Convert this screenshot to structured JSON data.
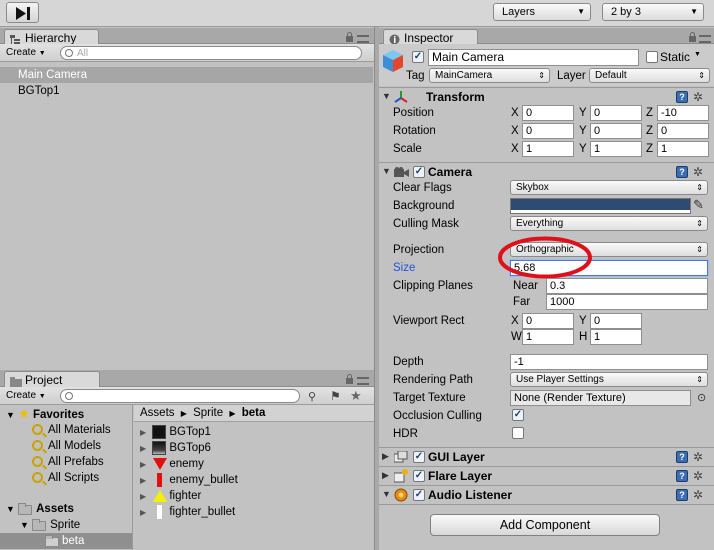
{
  "toolbar": {
    "step_icon": "step-forward-icon",
    "layers_label": "Layers",
    "layout_label": "2 by 3"
  },
  "hierarchy": {
    "tab_label": "Hierarchy",
    "create_label": "Create",
    "search_placeholder": "All",
    "items": [
      {
        "label": "Main Camera"
      },
      {
        "label": "BGTop1"
      }
    ]
  },
  "project": {
    "tab_label": "Project",
    "create_label": "Create",
    "favorites_label": "Favorites",
    "favorites": [
      "All Materials",
      "All Models",
      "All Prefabs",
      "All Scripts"
    ],
    "assets_label": "Assets",
    "sprite_label": "Sprite",
    "beta_label": "beta",
    "breadcrumb": [
      "Assets",
      "Sprite",
      "beta"
    ],
    "files": [
      "BGTop1",
      "BGTop6",
      "enemy",
      "enemy_bullet",
      "fighter",
      "fighter_bullet"
    ]
  },
  "inspector": {
    "tab_label": "Inspector",
    "object_name": "Main Camera",
    "static_label": "Static",
    "tag_label": "Tag",
    "tag_value": "MainCamera",
    "layer_label": "Layer",
    "layer_value": "Default",
    "transform": {
      "title": "Transform",
      "position_label": "Position",
      "rotation_label": "Rotation",
      "scale_label": "Scale",
      "axis_x": "X",
      "axis_y": "Y",
      "axis_z": "Z",
      "position": [
        "0",
        "0",
        "-10"
      ],
      "rotation": [
        "0",
        "0",
        "0"
      ],
      "scale": [
        "1",
        "1",
        "1"
      ]
    },
    "camera": {
      "title": "Camera",
      "clear_flags_label": "Clear Flags",
      "clear_flags_value": "Skybox",
      "background_label": "Background",
      "background_color": "#2f4a73",
      "culling_mask_label": "Culling Mask",
      "culling_mask_value": "Everything",
      "projection_label": "Projection",
      "projection_value": "Orthographic",
      "size_label": "Size",
      "size_value": "5.68",
      "clipping_label": "Clipping Planes",
      "near_label": "Near",
      "near_value": "0.3",
      "far_label": "Far",
      "far_value": "1000",
      "viewport_label": "Viewport Rect",
      "vp_x_label": "X",
      "vp_y_label": "Y",
      "vp_w_label": "W",
      "vp_h_label": "H",
      "vp_x": "0",
      "vp_y": "0",
      "vp_w": "1",
      "vp_h": "1",
      "depth_label": "Depth",
      "depth_value": "-1",
      "rendering_path_label": "Rendering Path",
      "rendering_path_value": "Use Player Settings",
      "target_texture_label": "Target Texture",
      "target_texture_value": "None (Render Texture)",
      "occlusion_label": "Occlusion Culling",
      "hdr_label": "HDR"
    },
    "gui_layer_title": "GUI Layer",
    "flare_layer_title": "Flare Layer",
    "audio_listener_title": "Audio Listener",
    "add_component_label": "Add Component",
    "highlight_color": "#e0101a"
  }
}
